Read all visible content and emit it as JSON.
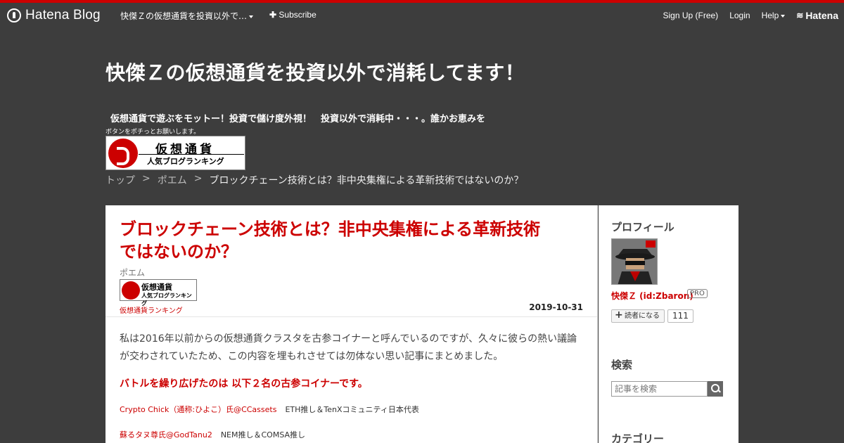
{
  "globalheader": {
    "logo_text": "Hatena Blog",
    "blog_name": "快傑Ｚの仮想通貨を投資以外で…",
    "subscribe": "Subscribe",
    "signup": "Sign Up (Free)",
    "login": "Login",
    "help": "Help",
    "hatena": "Hatena"
  },
  "blog": {
    "title": "快傑Ｚの仮想通貨を投資以外で消耗してます！",
    "description": "仮想通貨で遊ぶをモットー！投資で儲け度外視！　投資以外で消耗中・・・。誰かお恵みを",
    "description_small": "ボタンをポチっとお願いします。",
    "banner_line1": "仮想通貨",
    "banner_line2": "人気ブログランキング"
  },
  "breadcrumb": {
    "items": [
      "トップ",
      "ポエム",
      "ブロックチェーン技術とは？非中央集権による革新技術ではないのか？"
    ],
    "separator": ">"
  },
  "entry": {
    "title": "ブロックチェーン技術とは？非中央集権による革新技術ではないのか？",
    "category": "ポエム",
    "mini_banner_line1": "仮想通貨",
    "mini_banner_line2": "人気ブログランキング",
    "ranking_link": "仮想通貨ランキング",
    "date": "2019-10-31",
    "paragraph1": "私は2016年以前からの仮想通貨クラスタを古参コイナーと呼んでいるのですが、久々に彼らの熱い議論が交わされていたため、この内容を埋もれさせては勿体ない思い記事にまとめました。",
    "heading": "バトルを繰り広げたのは 以下２名の古参コイナーです。",
    "person1_name": "Crypto Chick（通称:ひよこ）氏@CCassets",
    "person1_note": "ETH推し＆TenXコミュニティ日本代表",
    "person2_name": "蘇るタヌ尊氏@GodTanu2",
    "person2_note": "NEM推し＆COMSA推し"
  },
  "sidebar": {
    "profile_heading": "プロフィール",
    "profile_name": "快傑Ｚ (id:Zbaron)",
    "pro_badge": "PRO",
    "subscribe_btn": "読者になる",
    "subscribers": "111",
    "search_heading": "検索",
    "search_placeholder": "記事を検索",
    "category_heading": "カテゴリー"
  },
  "colors": {
    "accent": "#cc0000",
    "background": "#3d3d3d",
    "top_line": "#cc0000"
  }
}
